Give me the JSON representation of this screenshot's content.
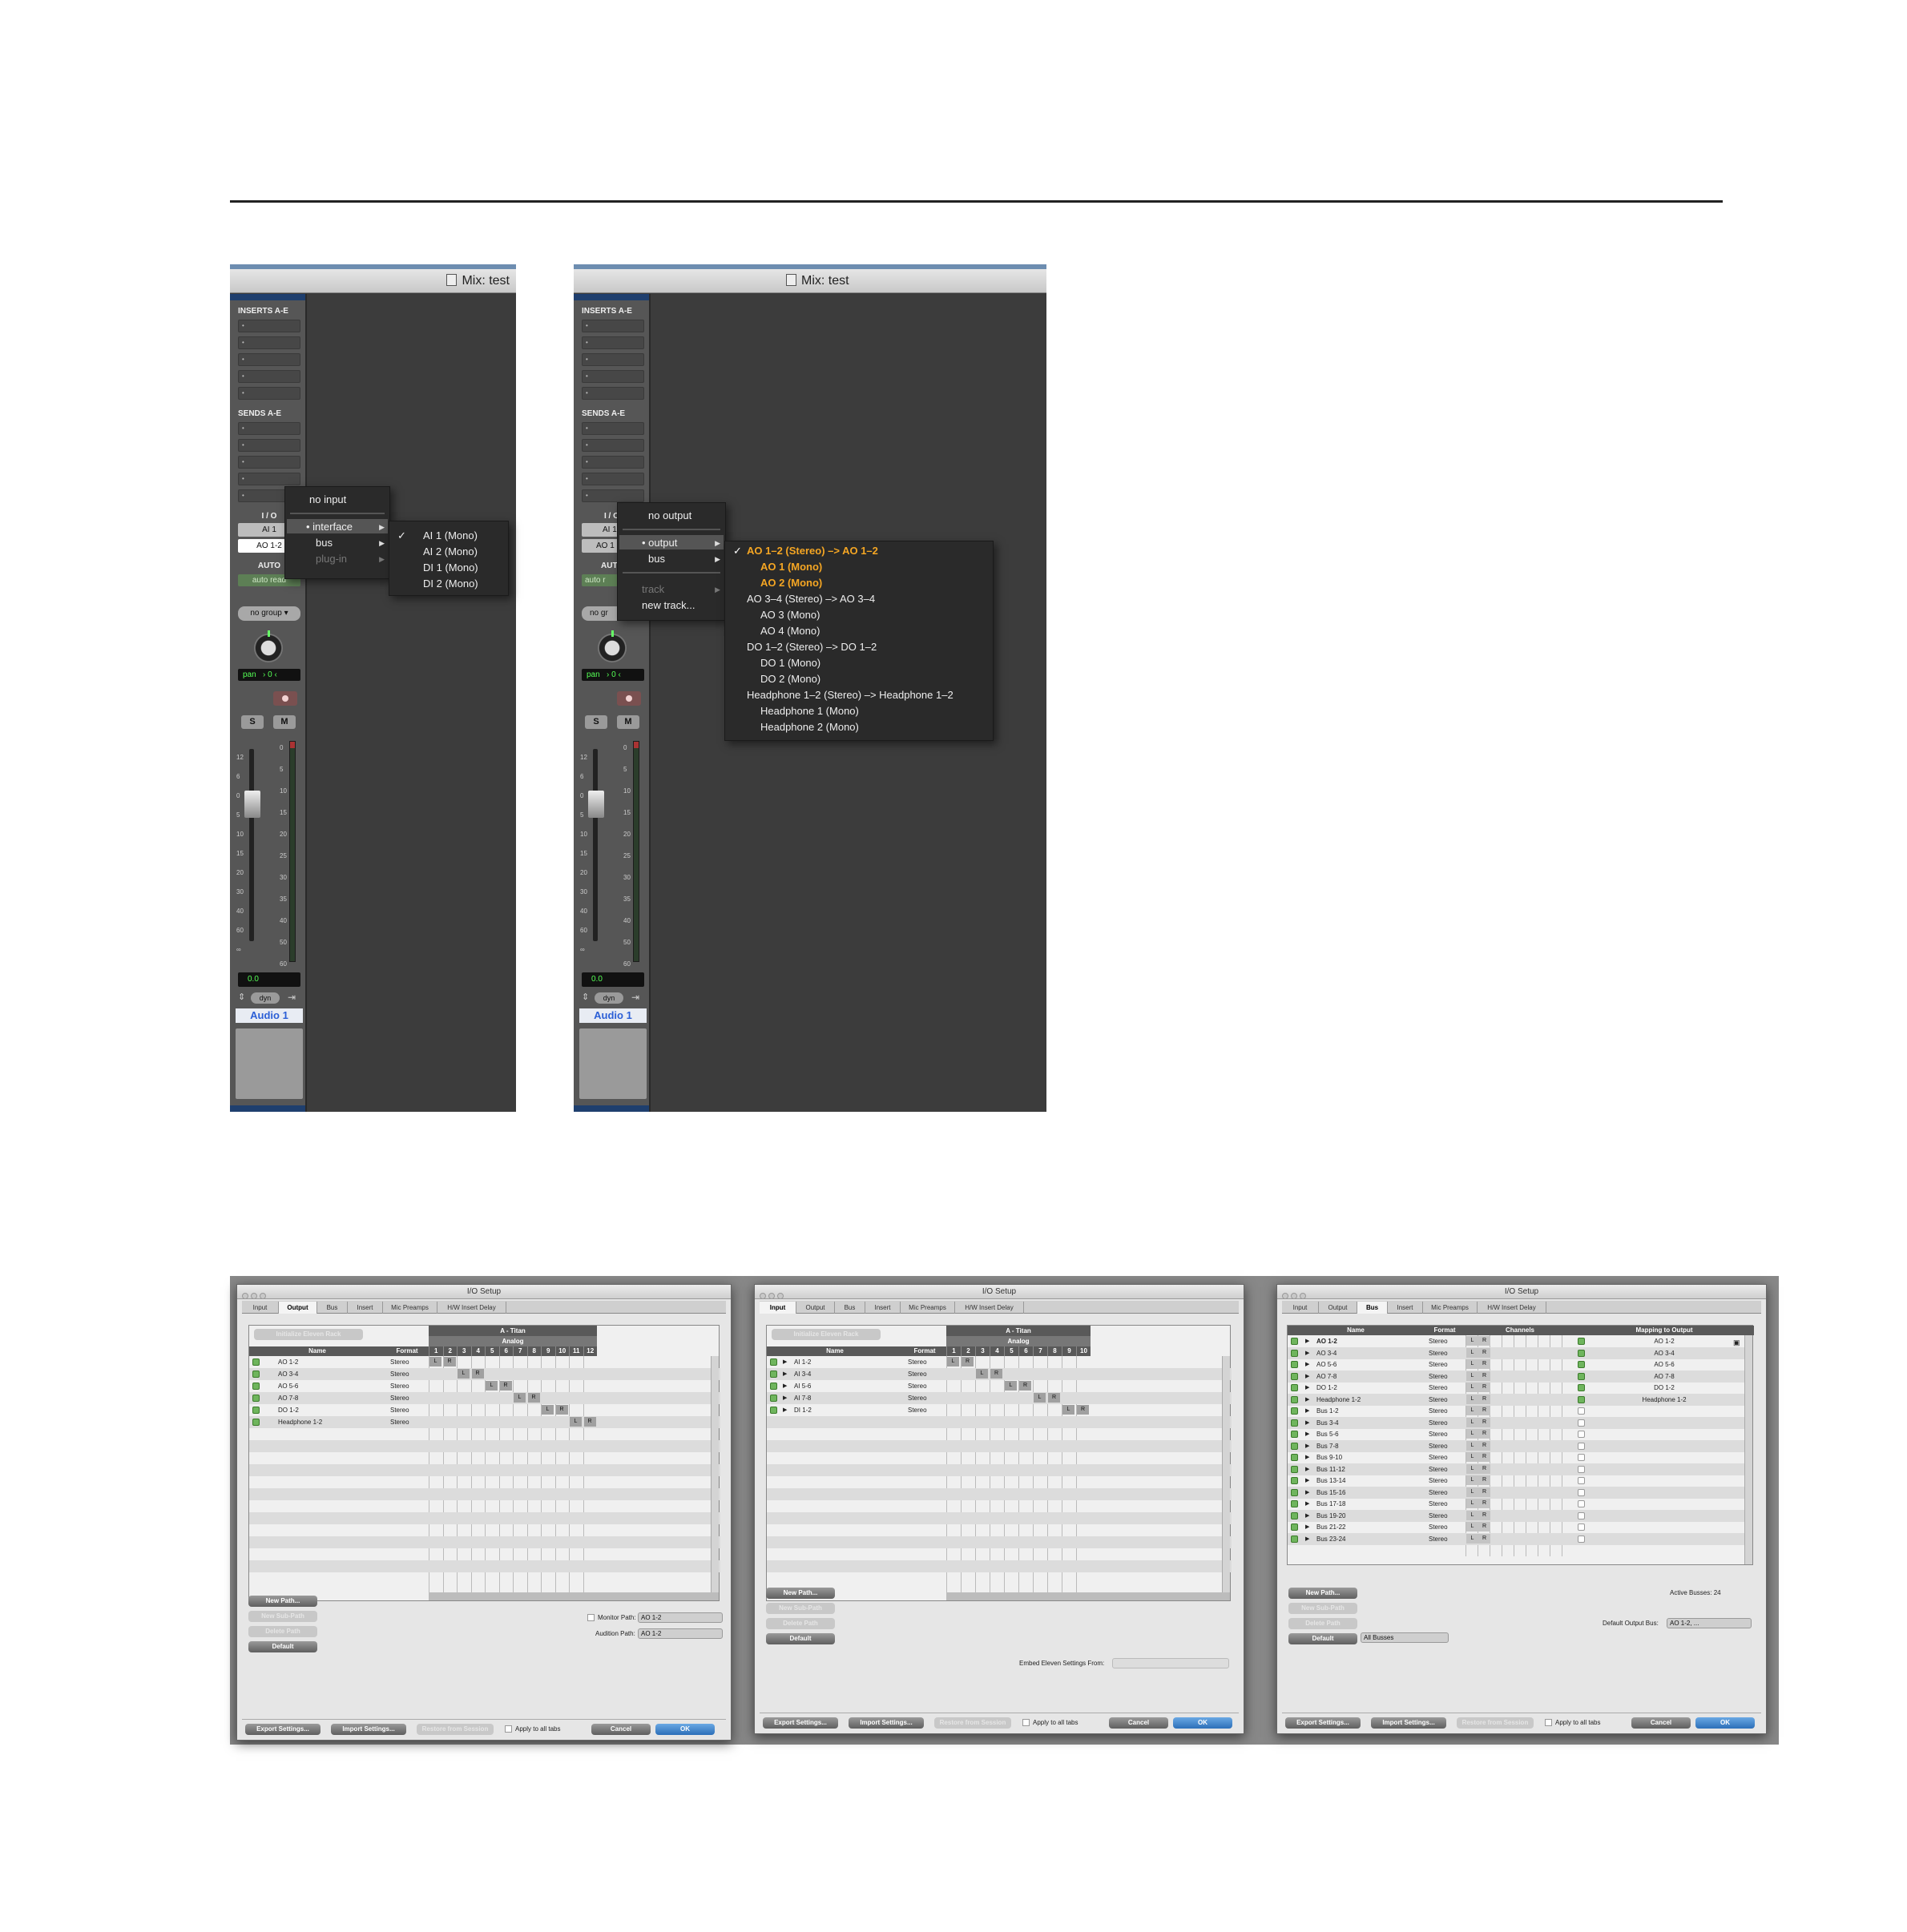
{
  "mix_left": {
    "title": "Mix: test",
    "inserts_label": "INSERTS A-E",
    "sends_label": "SENDS A-E",
    "io_label": "I / O",
    "input_value": "AI 1",
    "output_value": "AO 1-2",
    "auto_label": "AUTO",
    "auto_value": "auto read",
    "group_value": "no group",
    "pan_label": "pan",
    "pan_value": "0",
    "solo": "S",
    "mute": "M",
    "volume": "0.0",
    "dyn": "dyn",
    "track_name": "Audio 1",
    "fader_scale": [
      "12",
      "6",
      "0",
      "5",
      "10",
      "15",
      "20",
      "30",
      "40",
      "60",
      "∞"
    ],
    "meter_scale": [
      "0",
      "5",
      "10",
      "15",
      "20",
      "25",
      "30",
      "35",
      "40",
      "50",
      "60"
    ],
    "menu": {
      "no_input": "no input",
      "interface": "interface",
      "bus": "bus",
      "plugin": "plug-in"
    },
    "submenu": [
      "AI 1 (Mono)",
      "AI 2 (Mono)",
      "DI 1 (Mono)",
      "DI 2 (Mono)"
    ]
  },
  "mix_right": {
    "title": "Mix: test",
    "inserts_label": "INSERTS A-E",
    "sends_label": "SENDS A-E",
    "io_label": "I / O",
    "input_value": "AI 1",
    "output_value": "AO 1",
    "auto_label": "AUT",
    "auto_value": "auto r",
    "group_value": "no gr",
    "pan_label": "pan",
    "pan_value": "0",
    "solo": "S",
    "mute": "M",
    "volume": "0.0",
    "dyn": "dyn",
    "track_name": "Audio 1",
    "menu": {
      "no_output": "no output",
      "output": "output",
      "bus": "bus",
      "track": "track",
      "new_track": "new track..."
    },
    "submenu": [
      {
        "label": "AO 1–2 (Stereo) –> AO 1–2",
        "indent": false,
        "selected": true,
        "checked": true
      },
      {
        "label": "AO 1 (Mono)",
        "indent": true,
        "selected": true
      },
      {
        "label": "AO 2 (Mono)",
        "indent": true,
        "selected": true
      },
      {
        "label": "AO 3–4 (Stereo) –> AO 3–4",
        "indent": false
      },
      {
        "label": "AO 3 (Mono)",
        "indent": true
      },
      {
        "label": "AO 4 (Mono)",
        "indent": true
      },
      {
        "label": "DO 1–2 (Stereo) –> DO 1–2",
        "indent": false
      },
      {
        "label": "DO 1 (Mono)",
        "indent": true
      },
      {
        "label": "DO 2 (Mono)",
        "indent": true
      },
      {
        "label": "Headphone 1–2 (Stereo) –> Headphone 1–2",
        "indent": false
      },
      {
        "label": "Headphone 1 (Mono)",
        "indent": true
      },
      {
        "label": "Headphone 2 (Mono)",
        "indent": true
      }
    ]
  },
  "io_setup": {
    "title": "I/O Setup",
    "tabs": [
      "Input",
      "Output",
      "Bus",
      "Insert",
      "Mic Preamps",
      "H/W Insert Delay"
    ],
    "output_dialog": {
      "active_tab": "Output",
      "top_button": "Initialize Eleven Rack",
      "device": "A - Titan",
      "group": "Analog",
      "col_name": "Name",
      "col_format": "Format",
      "channels": [
        "1",
        "2",
        "3",
        "4",
        "5",
        "6",
        "7",
        "8",
        "9",
        "10",
        "11",
        "12"
      ],
      "rows": [
        {
          "name": "AO 1-2",
          "format": "Stereo",
          "ch": 0
        },
        {
          "name": "AO 3-4",
          "format": "Stereo",
          "ch": 2
        },
        {
          "name": "AO 5-6",
          "format": "Stereo",
          "ch": 4
        },
        {
          "name": "AO 7-8",
          "format": "Stereo",
          "ch": 6
        },
        {
          "name": "DO 1-2",
          "format": "Stereo",
          "ch": 8
        },
        {
          "name": "Headphone 1-2",
          "format": "Stereo",
          "ch": 10
        }
      ],
      "buttons": [
        "New Path...",
        "New Sub-Path",
        "Delete Path",
        "Default"
      ],
      "monitor_label": "Monitor Path:",
      "monitor_value": "AO 1-2",
      "audition_label": "Audition Path:",
      "audition_value": "AO 1-2"
    },
    "input_dialog": {
      "active_tab": "Input",
      "top_button": "Initialize Eleven Rack",
      "device": "A - Titan",
      "group": "Analog",
      "col_name": "Name",
      "col_format": "Format",
      "channels": [
        "1",
        "2",
        "3",
        "4",
        "5",
        "6",
        "7",
        "8",
        "9",
        "10"
      ],
      "rows": [
        {
          "name": "AI 1-2",
          "format": "Stereo",
          "ch": 0
        },
        {
          "name": "AI 3-4",
          "format": "Stereo",
          "ch": 2
        },
        {
          "name": "AI 5-6",
          "format": "Stereo",
          "ch": 4
        },
        {
          "name": "AI 7-8",
          "format": "Stereo",
          "ch": 6
        },
        {
          "name": "DI 1-2",
          "format": "Stereo",
          "ch": 8
        }
      ],
      "buttons": [
        "New Path...",
        "New Sub-Path",
        "Delete Path",
        "Default"
      ],
      "embed_label": "Embed Eleven Settings From:"
    },
    "bus_dialog": {
      "active_tab": "Bus",
      "col_name": "Name",
      "col_format": "Format",
      "col_channels": "Channels",
      "col_mapping": "Mapping to Output",
      "rows": [
        {
          "name": "AO 1-2",
          "format": "Stereo",
          "map": "AO 1-2",
          "mapped": true
        },
        {
          "name": "AO 3-4",
          "format": "Stereo",
          "map": "AO 3-4",
          "mapped": true
        },
        {
          "name": "AO 5-6",
          "format": "Stereo",
          "map": "AO 5-6",
          "mapped": true
        },
        {
          "name": "AO 7-8",
          "format": "Stereo",
          "map": "AO 7-8",
          "mapped": true
        },
        {
          "name": "DO 1-2",
          "format": "Stereo",
          "map": "DO 1-2",
          "mapped": true
        },
        {
          "name": "Headphone 1-2",
          "format": "Stereo",
          "map": "Headphone 1-2",
          "mapped": true
        },
        {
          "name": "Bus 1-2",
          "format": "Stereo",
          "map": "",
          "mapped": false
        },
        {
          "name": "Bus 3-4",
          "format": "Stereo",
          "map": "",
          "mapped": false
        },
        {
          "name": "Bus 5-6",
          "format": "Stereo",
          "map": "",
          "mapped": false
        },
        {
          "name": "Bus 7-8",
          "format": "Stereo",
          "map": "",
          "mapped": false
        },
        {
          "name": "Bus 9-10",
          "format": "Stereo",
          "map": "",
          "mapped": false
        },
        {
          "name": "Bus 11-12",
          "format": "Stereo",
          "map": "",
          "mapped": false
        },
        {
          "name": "Bus 13-14",
          "format": "Stereo",
          "map": "",
          "mapped": false
        },
        {
          "name": "Bus 15-16",
          "format": "Stereo",
          "map": "",
          "mapped": false
        },
        {
          "name": "Bus 17-18",
          "format": "Stereo",
          "map": "",
          "mapped": false
        },
        {
          "name": "Bus 19-20",
          "format": "Stereo",
          "map": "",
          "mapped": false
        },
        {
          "name": "Bus 21-22",
          "format": "Stereo",
          "map": "",
          "mapped": false
        },
        {
          "name": "Bus 23-24",
          "format": "Stereo",
          "map": "",
          "mapped": false
        }
      ],
      "buttons": [
        "New Path...",
        "New Sub-Path",
        "Delete Path",
        "Default"
      ],
      "default_select": "All Busses",
      "active_busses": "Active Busses:  24",
      "default_output_label": "Default Output Bus:",
      "default_output_value": "AO 1-2, ..."
    },
    "footer": {
      "export": "Export Settings...",
      "import": "Import Settings...",
      "restore": "Restore from Session",
      "apply_all": "Apply to all tabs",
      "cancel": "Cancel",
      "ok": "OK"
    }
  },
  "colors": {
    "accent_orange": "#f5a623",
    "ok_blue": "#2c6fb8",
    "meter_green": "#55ff55"
  }
}
